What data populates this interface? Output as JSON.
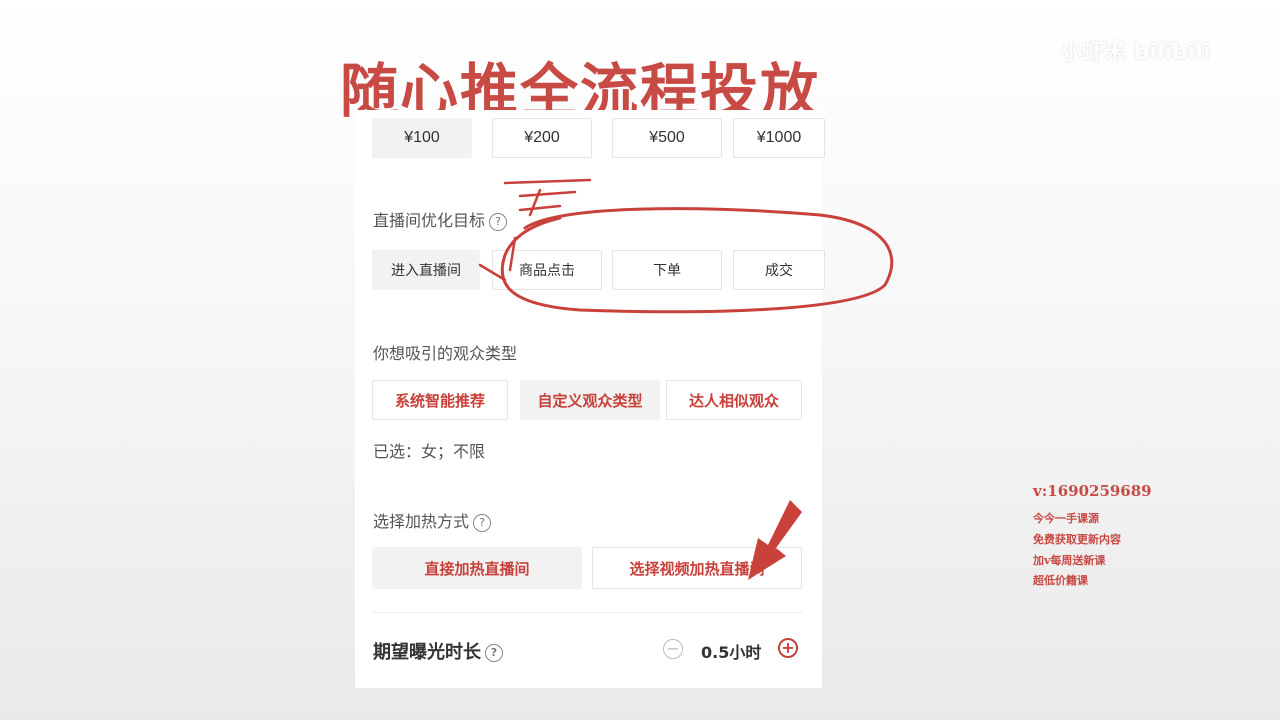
{
  "title": "随心推全流程投放",
  "watermark": "小虾米 bilibili",
  "budget": {
    "options": [
      "¥100",
      "¥200",
      "¥500",
      "¥1000"
    ],
    "selected": "¥100"
  },
  "goal": {
    "label": "直播间优化目标",
    "options": [
      "进入直播间",
      "商品点击",
      "下单",
      "成交"
    ],
    "selected": "进入直播间"
  },
  "audience": {
    "label": "你想吸引的观众类型",
    "options": [
      "系统智能推荐",
      "自定义观众类型",
      "达人相似观众"
    ],
    "selected": "自定义观众类型",
    "selected_text": "已选：女；不限"
  },
  "heat": {
    "label": "选择加热方式",
    "options": [
      "直接加热直播间",
      "选择视频加热直播间"
    ],
    "selected": "直接加热直播间"
  },
  "duration": {
    "label": "期望曝光时长",
    "value": "0.5小时",
    "minus": "−",
    "plus": "+"
  },
  "side_notes": {
    "contact": "v:1690259689",
    "line1": "今今一手课源",
    "line2": "免费获取更新内容",
    "line3": "加v每周送新课",
    "line4": "超低价籍课"
  },
  "colors": {
    "accent": "#c84a45",
    "annotation": "#c8413b"
  }
}
